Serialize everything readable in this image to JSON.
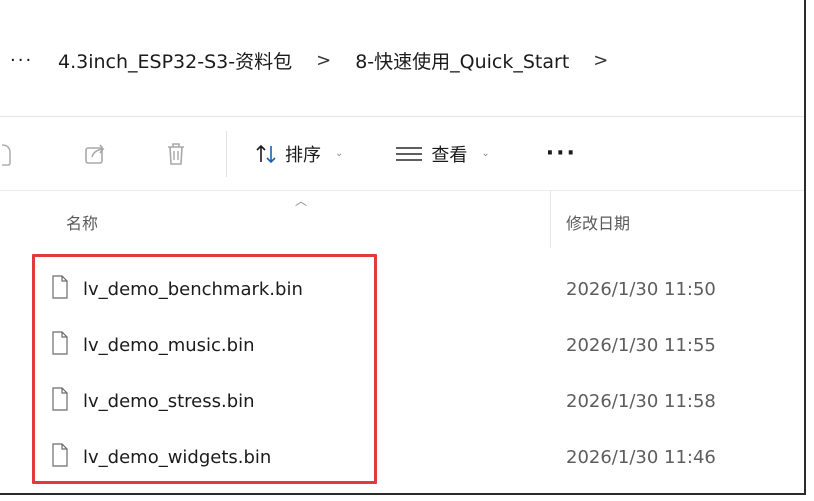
{
  "address_bar": {
    "overflow_label": "···",
    "crumbs": [
      "4.3inch_ESP32-S3-资料包",
      "8-快速使用_Quick_Start"
    ],
    "separator": ">"
  },
  "toolbar": {
    "sort_label": "排序",
    "view_label": "查看",
    "more_label": "···"
  },
  "columns": {
    "name": "名称",
    "modified": "修改日期"
  },
  "files": [
    {
      "name": "lv_demo_benchmark.bin",
      "modified": "2026/1/30 11:50"
    },
    {
      "name": "lv_demo_music.bin",
      "modified": "2026/1/30 11:55"
    },
    {
      "name": "lv_demo_stress.bin",
      "modified": "2026/1/30 11:58"
    },
    {
      "name": "lv_demo_widgets.bin",
      "modified": "2026/1/30 11:46"
    }
  ],
  "icons": {
    "toolbar": [
      "copy-icon",
      "share-icon",
      "delete-icon",
      "sort-icon",
      "view-icon"
    ],
    "file": "file-icon"
  },
  "colors": {
    "highlight": "#e03a3a"
  }
}
